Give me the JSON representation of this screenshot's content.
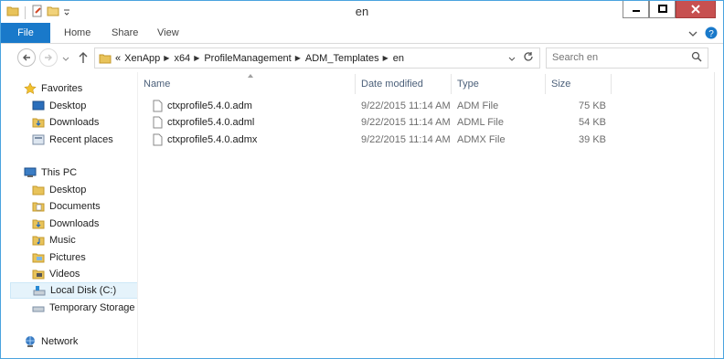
{
  "window": {
    "title": "en"
  },
  "ribbon": {
    "tabs": [
      "File",
      "Home",
      "Share",
      "View"
    ]
  },
  "address": {
    "overflow": "«",
    "crumbs": [
      "XenApp",
      "x64",
      "ProfileManagement",
      "ADM_Templates",
      "en"
    ]
  },
  "search": {
    "placeholder": "Search en"
  },
  "nav": {
    "favorites": {
      "label": "Favorites",
      "items": [
        "Desktop",
        "Downloads",
        "Recent places"
      ]
    },
    "this_pc": {
      "label": "This PC",
      "items": [
        "Desktop",
        "Documents",
        "Downloads",
        "Music",
        "Pictures",
        "Videos",
        "Local Disk (C:)",
        "Temporary Storage "
      ]
    },
    "network": {
      "label": "Network"
    },
    "selected": "Local Disk (C:)"
  },
  "columns": [
    "Name",
    "Date modified",
    "Type",
    "Size"
  ],
  "files": [
    {
      "name": "ctxprofile5.4.0.adm",
      "date": "9/22/2015 11:14 AM",
      "type": "ADM File",
      "size": "75 KB"
    },
    {
      "name": "ctxprofile5.4.0.adml",
      "date": "9/22/2015 11:14 AM",
      "type": "ADML File",
      "size": "54 KB"
    },
    {
      "name": "ctxprofile5.4.0.admx",
      "date": "9/22/2015 11:14 AM",
      "type": "ADMX File",
      "size": "39 KB"
    }
  ],
  "colors": {
    "accent": "#1979ca",
    "border": "#4aa3df",
    "selection": "#e5f3fb",
    "header_text": "#4c607a"
  }
}
